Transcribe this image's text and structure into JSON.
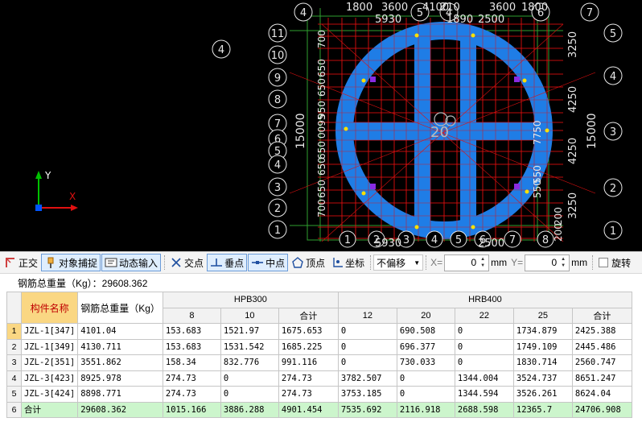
{
  "cad": {
    "top_dims": [
      "1800",
      "3600",
      "4100",
      "210",
      "3600",
      "1800"
    ],
    "top_dims2": [
      "5930",
      "1890",
      "2500"
    ],
    "top_axes": [
      "4",
      "5",
      "4",
      "6",
      "7"
    ],
    "left_axes": [
      "11",
      "10",
      "9",
      "8",
      "7",
      "6",
      "5",
      "4",
      "3",
      "2",
      "1"
    ],
    "left_dims": [
      "700",
      "650",
      "650",
      "950",
      "0095",
      "650",
      "650",
      "650",
      "700"
    ],
    "left_total": "15000",
    "right_axes": [
      "5",
      "4",
      "3",
      "2",
      "1"
    ],
    "right_dims": [
      "3250",
      "4250",
      "4250",
      "3250"
    ],
    "right_total": "15000",
    "inner_dims": [
      "7750",
      "550",
      "550",
      "200",
      "200"
    ],
    "bottom_dims": [
      "5930",
      "2500"
    ],
    "bottom_axes": [
      "1",
      "2",
      "3",
      "4",
      "5",
      "6",
      "7",
      "8"
    ],
    "far_left_axis": "4",
    "center_label": "20",
    "ucs": {
      "x": "X",
      "y": "Y"
    }
  },
  "toolbar": {
    "ortho": "正交",
    "object_snap": "对象捕捉",
    "dynamic_input": "动态输入",
    "intersection": "交点",
    "perpendicular": "垂点",
    "midpoint": "中点",
    "vertex": "顶点",
    "coordinate": "坐标",
    "offset_mode": "不偏移",
    "x_label": "X=",
    "x_value": "0",
    "x_unit": "mm",
    "y_label": "Y=",
    "y_value": "0",
    "y_unit": "mm",
    "rotate": "旋转"
  },
  "summary": {
    "text": "钢筋总重量（Kg）：29608.362"
  },
  "table": {
    "col_name": "构件名称",
    "col_weight": "钢筋总重量（Kg）",
    "group_hpb": "HPB300",
    "group_hrb": "HRB400",
    "hpb_cols": [
      "8",
      "10",
      "合计"
    ],
    "hrb_cols": [
      "12",
      "20",
      "22",
      "25",
      "合计"
    ],
    "rows": [
      {
        "n": "1",
        "name": "JZL-1[347]",
        "weight": "4101.04",
        "v": [
          "153.683",
          "1521.97",
          "1675.653",
          "0",
          "690.508",
          "0",
          "1734.879",
          "2425.388"
        ]
      },
      {
        "n": "2",
        "name": "JZL-1[349]",
        "weight": "4130.711",
        "v": [
          "153.683",
          "1531.542",
          "1685.225",
          "0",
          "696.377",
          "0",
          "1749.109",
          "2445.486"
        ]
      },
      {
        "n": "3",
        "name": "JZL-2[351]",
        "weight": "3551.862",
        "v": [
          "158.34",
          "832.776",
          "991.116",
          "0",
          "730.033",
          "0",
          "1830.714",
          "2560.747"
        ]
      },
      {
        "n": "4",
        "name": "JZL-3[423]",
        "weight": "8925.978",
        "v": [
          "274.73",
          "0",
          "274.73",
          "3782.507",
          "0",
          "1344.004",
          "3524.737",
          "8651.247"
        ]
      },
      {
        "n": "5",
        "name": "JZL-3[424]",
        "weight": "8898.771",
        "v": [
          "274.73",
          "0",
          "274.73",
          "3753.185",
          "0",
          "1344.594",
          "3526.261",
          "8624.04"
        ]
      },
      {
        "n": "6",
        "name": "合计",
        "weight": "29608.362",
        "v": [
          "1015.166",
          "3886.288",
          "4901.454",
          "7535.692",
          "2116.918",
          "2688.598",
          "12365.7",
          "24706.908"
        ]
      }
    ]
  },
  "colors": {
    "cad_bg": "#000000",
    "ring": "#1f7de6",
    "grid_red": "#e01010",
    "grid_green": "#2fa02f",
    "header_orange": "#fad783",
    "total_green": "#ccf5cc"
  }
}
